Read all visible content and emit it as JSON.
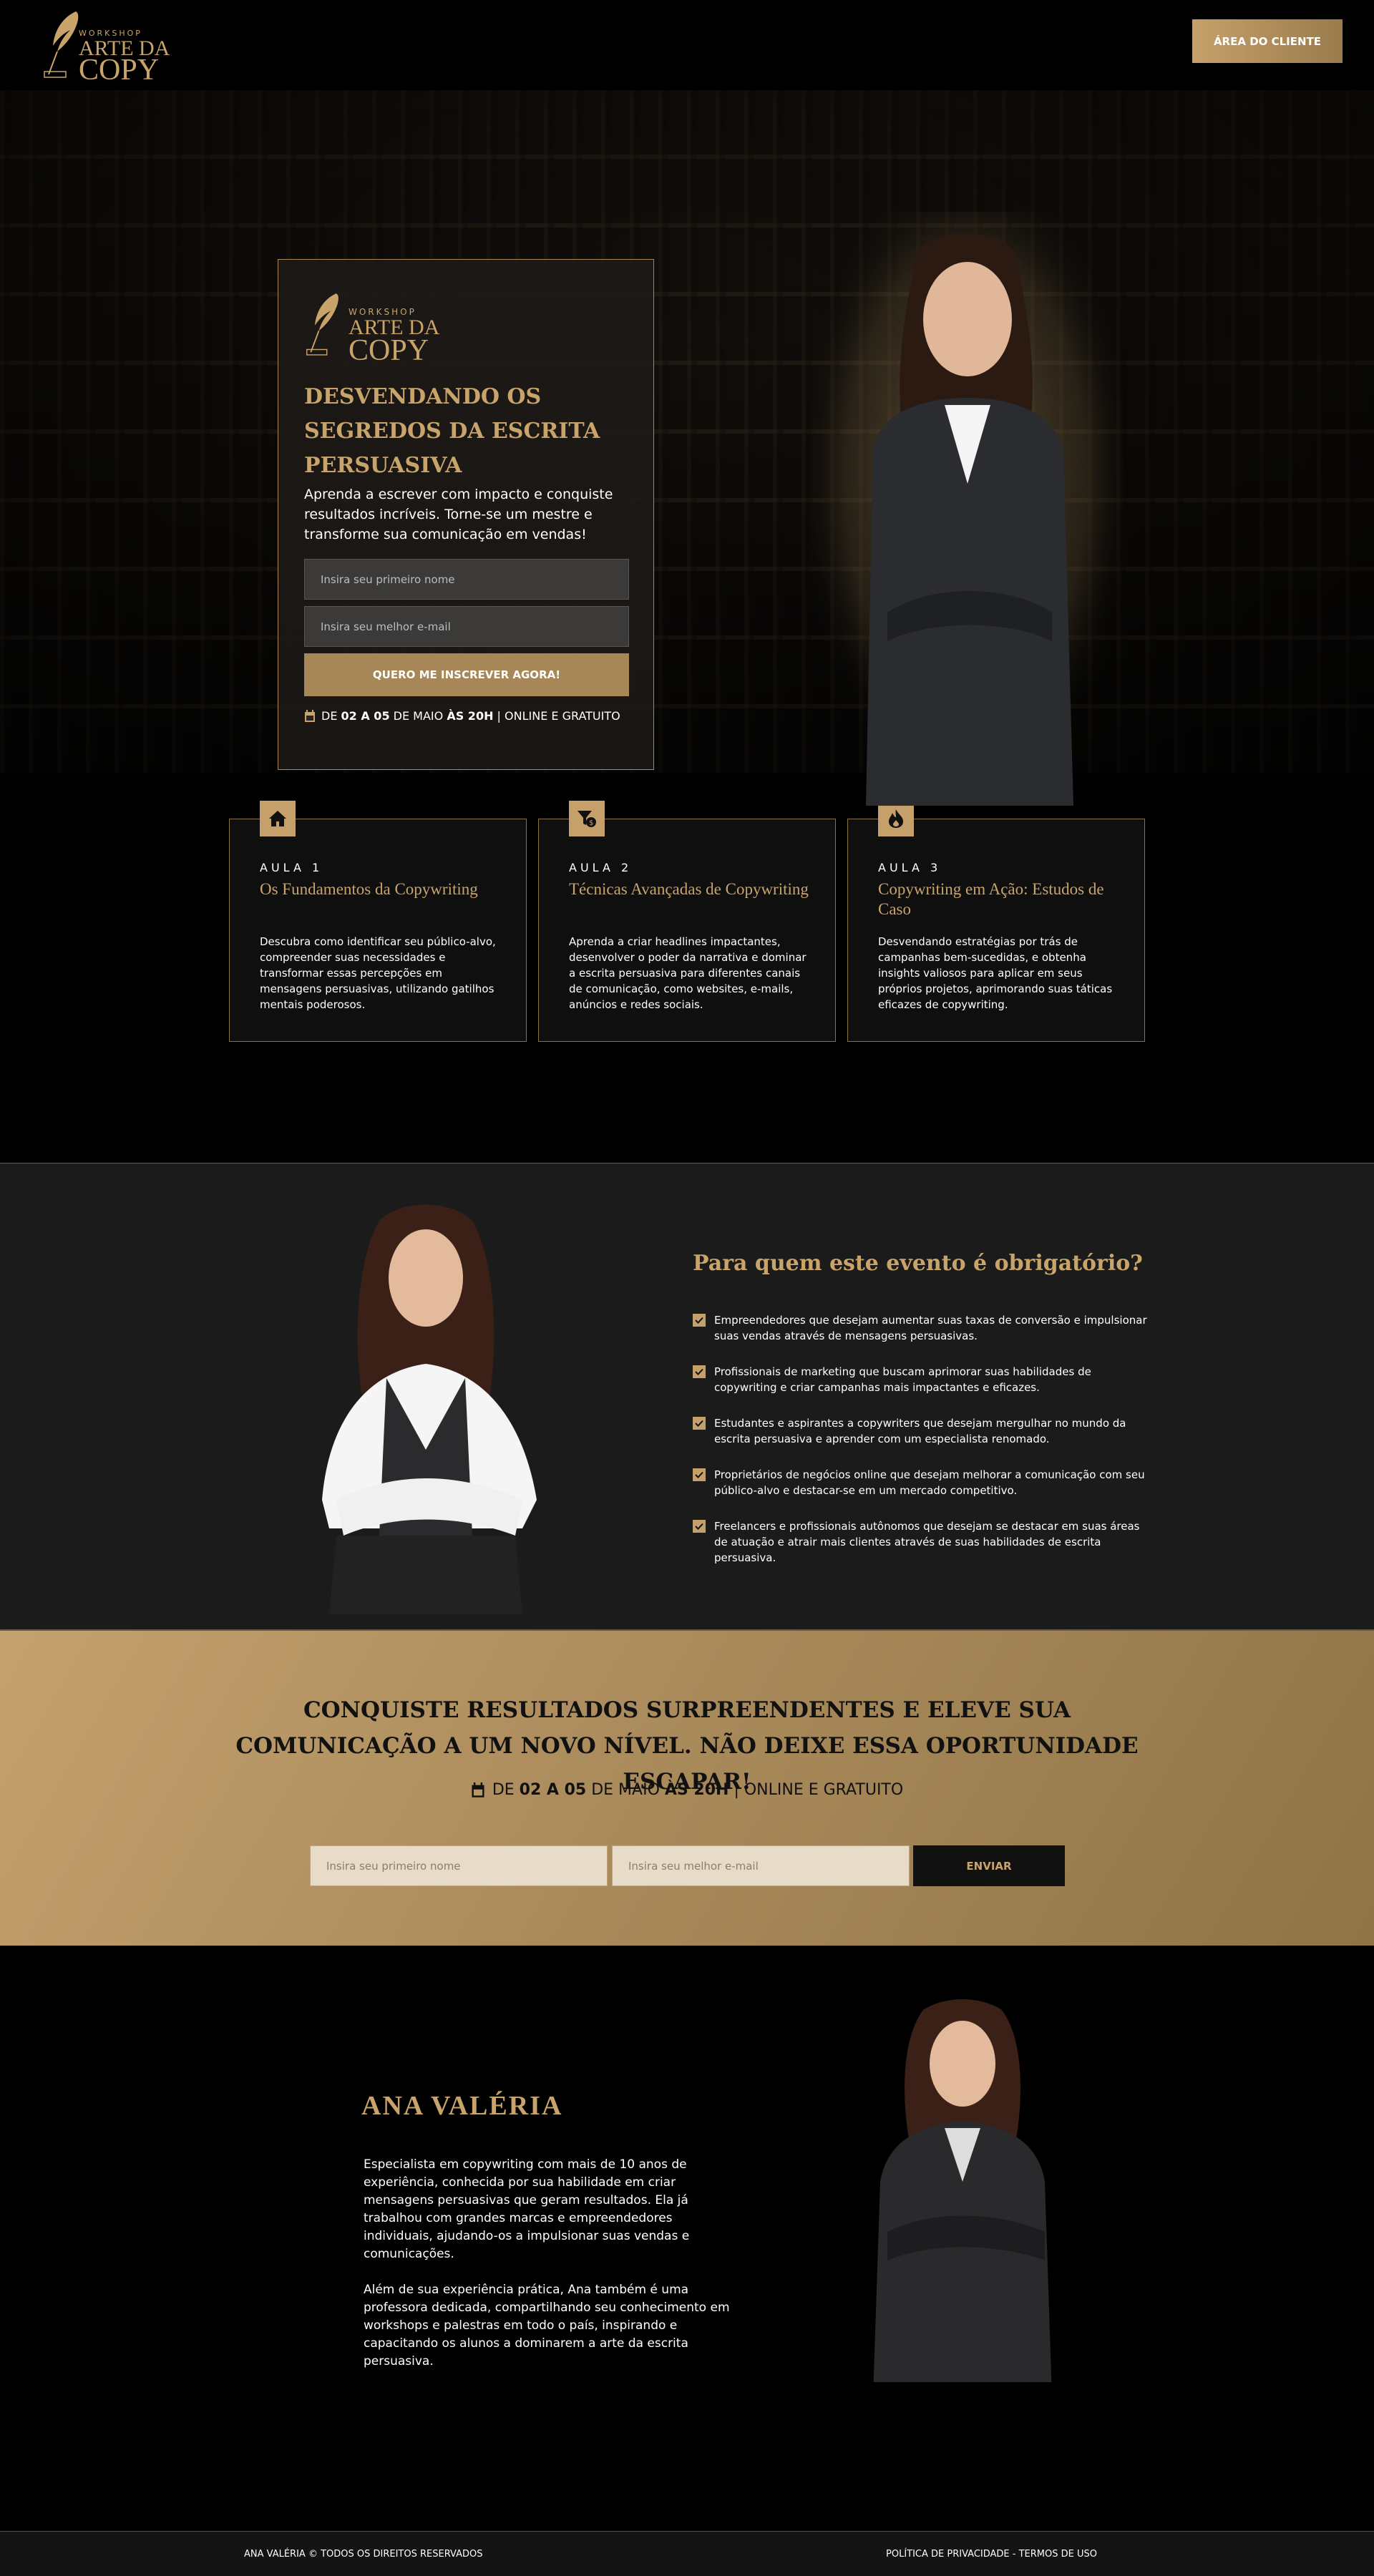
{
  "header": {
    "logo": {
      "small": "WORKSHOP",
      "line1": "ARTE DA",
      "line2": "COPY"
    },
    "client_button": "ÁREA DO CLIENTE"
  },
  "hero": {
    "logo": {
      "small": "WORKSHOP",
      "line1": "ARTE DA",
      "line2": "COPY"
    },
    "title": "DESVENDANDO OS SEGREDOS DA ESCRITA PERSUASIVA",
    "subtitle": "Aprenda a escrever com impacto e conquiste resultados incríveis. Torne-se um mestre e transforme sua comunicação em vendas!",
    "name_placeholder": "Insira seu primeiro nome",
    "email_placeholder": "Insira seu melhor e-mail",
    "submit_label": "QUERO ME INSCREVER AGORA!",
    "date": {
      "pre": "DE ",
      "range": "02 A 05",
      "mid": " DE MAIO ",
      "time": "ÀS 20H",
      "post": " | ONLINE E GRATUITO"
    }
  },
  "aulas": [
    {
      "num": "AULA 1",
      "title": "Os Fundamentos da Copywriting",
      "icon": "home-icon",
      "text": "Descubra como identificar seu público-alvo, compreender suas necessidades e transformar essas percepções em mensagens persuasivas, utilizando gatilhos mentais poderosos."
    },
    {
      "num": "AULA 2",
      "title": "Técnicas Avançadas de Copywriting",
      "icon": "funnel-dollar-icon",
      "text": "Aprenda a criar headlines impactantes, desenvolver o poder da narrativa e dominar a escrita persuasiva para diferentes canais de comunicação, como websites, e-mails, anúncios e redes sociais."
    },
    {
      "num": "AULA 3",
      "title": "Copywriting em Ação: Estudos de Caso",
      "icon": "fire-icon",
      "text": "Desvendando estratégias por trás de campanhas bem-sucedidas, e obtenha insights valiosos para aplicar em seus próprios projetos, aprimorando suas táticas eficazes de copywriting."
    }
  ],
  "quem": {
    "title": "Para quem este evento é obrigatório?",
    "items": [
      "Empreendedores que desejam aumentar suas taxas de conversão e impulsionar suas vendas através de mensagens persuasivas.",
      "Profissionais de marketing que buscam aprimorar suas habilidades de copywriting e criar campanhas mais impactantes e eficazes.",
      "Estudantes e aspirantes a copywriters que desejam mergulhar no mundo da escrita persuasiva e aprender com um especialista renomado.",
      "Proprietários de negócios online que desejam melhorar a comunicação com seu público-alvo e destacar-se em um mercado competitivo.",
      "Freelancers e profissionais autônomos que desejam se destacar em suas áreas de atuação e atrair mais clientes através de suas habilidades de escrita persuasiva."
    ]
  },
  "cta": {
    "title": "CONQUISTE RESULTADOS SURPREENDENTES E ELEVE SUA COMUNICAÇÃO A UM NOVO NÍVEL. NÃO DEIXE ESSA OPORTUNIDADE ESCAPAR!",
    "date": {
      "pre": "DE ",
      "range": "02 A 05",
      "mid": " DE MAIO ",
      "time": "ÀS 20H",
      "post": " | ONLINE E GRATUITO"
    },
    "name_placeholder": "Insira seu primeiro nome",
    "email_placeholder": "Insira seu melhor e-mail",
    "submit_label": "ENVIAR"
  },
  "about": {
    "name": "ANA VALÉRIA",
    "p1": "Especialista em copywriting com mais de 10 anos de experiência, conhecida por sua habilidade em criar mensagens persuasivas que geram resultados. Ela já trabalhou com grandes marcas e empreendedores individuais, ajudando-os a impulsionar suas vendas e comunicações.",
    "p2": "Além de sua experiência prática, Ana também é uma professora dedicada, compartilhando seu conhecimento em workshops e palestras em todo o país, inspirando e capacitando os alunos a dominarem a arte da escrita persuasiva."
  },
  "footer": {
    "left": "ANA VALÉRIA © TODOS OS DIREITOS RESERVADOS",
    "right": "POLÍTICA DE PRIVACIDADE - TERMOS DE USO"
  },
  "colors": {
    "gold": "#c9a46a",
    "gold_dark": "#a78657",
    "bg": "#000000"
  }
}
